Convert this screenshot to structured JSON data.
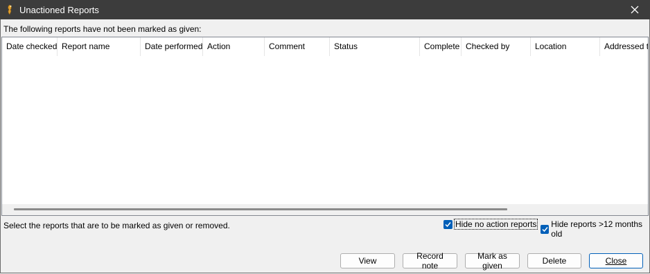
{
  "window": {
    "title": "Unactioned Reports"
  },
  "intro_text": "The following reports have not been marked as given:",
  "table": {
    "columns": [
      "Date checked",
      "Report name",
      "Date performed",
      "Action",
      "Comment",
      "Status",
      "Complete",
      "Checked by",
      "Location",
      "Addressed to"
    ],
    "rows": []
  },
  "instruction_text": "Select the reports that are to be marked as given or removed.",
  "options": {
    "hide_no_action": {
      "label": "Hide no action reports",
      "checked": true
    },
    "hide_old": {
      "label": "Hide reports >12 months old",
      "checked": true
    }
  },
  "buttons": {
    "view": "View",
    "record_note": "Record note",
    "mark_given": "Mark as given",
    "delete": "Delete",
    "close": "Close"
  },
  "colors": {
    "titlebar": "#3c3c3c",
    "checkbox_accent": "#005fb8"
  }
}
